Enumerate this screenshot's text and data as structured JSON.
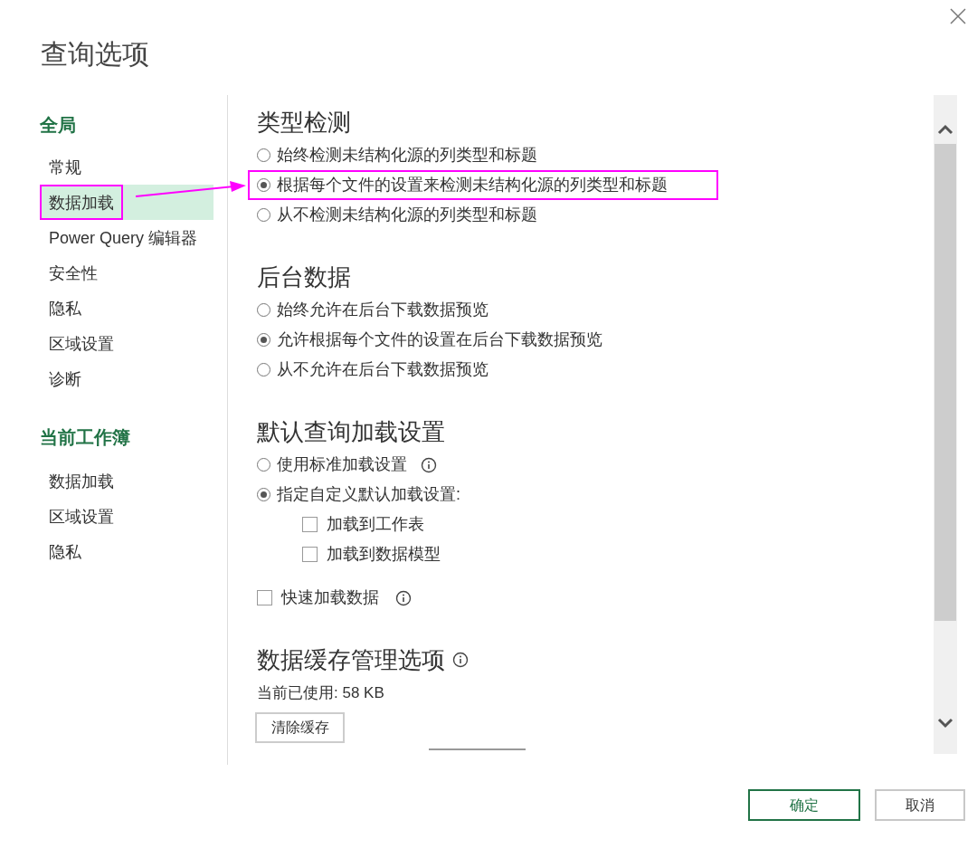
{
  "window": {
    "title": "查询选项"
  },
  "sidebar": {
    "groups": [
      {
        "heading": "全局",
        "items": [
          {
            "label": "常规",
            "selected": false,
            "highlighted": false
          },
          {
            "label": "数据加载",
            "selected": true,
            "highlighted": true
          },
          {
            "label": "Power Query 编辑器",
            "selected": false,
            "highlighted": false
          },
          {
            "label": "安全性",
            "selected": false,
            "highlighted": false
          },
          {
            "label": "隐私",
            "selected": false,
            "highlighted": false
          },
          {
            "label": "区域设置",
            "selected": false,
            "highlighted": false
          },
          {
            "label": "诊断",
            "selected": false,
            "highlighted": false
          }
        ]
      },
      {
        "heading": "当前工作簿",
        "items": [
          {
            "label": "数据加载",
            "selected": false,
            "highlighted": false
          },
          {
            "label": "区域设置",
            "selected": false,
            "highlighted": false
          },
          {
            "label": "隐私",
            "selected": false,
            "highlighted": false
          }
        ]
      }
    ]
  },
  "sections": [
    {
      "heading": "类型检测",
      "options": [
        {
          "kind": "radio",
          "label": "始终检测未结构化源的列类型和标题",
          "checked": false
        },
        {
          "kind": "radio",
          "label": "根据每个文件的设置来检测未结构化源的列类型和标题",
          "checked": true,
          "highlighted": true
        },
        {
          "kind": "radio",
          "label": "从不检测未结构化源的列类型和标题",
          "checked": false
        }
      ]
    },
    {
      "heading": "后台数据",
      "options": [
        {
          "kind": "radio",
          "label": "始终允许在后台下载数据预览",
          "checked": false
        },
        {
          "kind": "radio",
          "label": "允许根据每个文件的设置在后台下载数据预览",
          "checked": true
        },
        {
          "kind": "radio",
          "label": "从不允许在后台下载数据预览",
          "checked": false
        }
      ]
    },
    {
      "heading": "默认查询加载设置",
      "options": [
        {
          "kind": "radio",
          "label": "使用标准加载设置",
          "checked": false,
          "info": true
        },
        {
          "kind": "radio",
          "label": "指定自定义默认加载设置:",
          "checked": true
        },
        {
          "kind": "subcheckbox",
          "label": "加载到工作表",
          "checked": false
        },
        {
          "kind": "subcheckbox",
          "label": "加载到数据模型",
          "checked": false
        },
        {
          "kind": "checkbox",
          "label": "快速加载数据",
          "checked": false,
          "info": true
        }
      ]
    },
    {
      "heading": "数据缓存管理选项",
      "info": true,
      "options": [
        {
          "kind": "text",
          "label": "当前已使用: 58 KB"
        },
        {
          "kind": "button",
          "label": "清除缓存"
        }
      ]
    }
  ],
  "buttons": [
    {
      "label": "确定",
      "primary": true
    },
    {
      "label": "取消",
      "primary": false
    }
  ]
}
